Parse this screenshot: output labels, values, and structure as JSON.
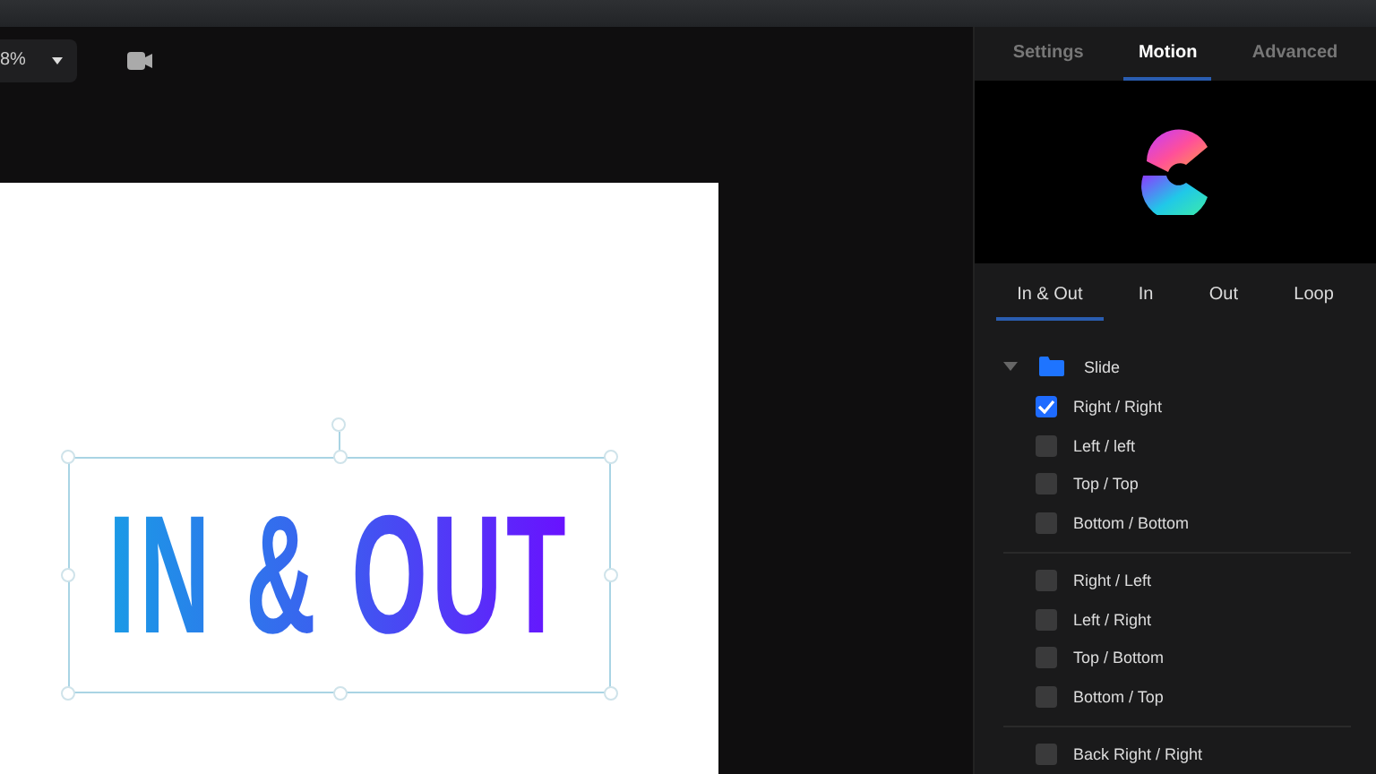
{
  "toolbar": {
    "zoom": "8%"
  },
  "canvas": {
    "text": "IN & OUT"
  },
  "panel": {
    "tabs": [
      {
        "label": "Settings",
        "selected": false
      },
      {
        "label": "Motion",
        "selected": true
      },
      {
        "label": "Advanced",
        "selected": false
      }
    ],
    "subtabs": [
      {
        "label": "In & Out",
        "selected": true
      },
      {
        "label": "In",
        "selected": false
      },
      {
        "label": "Out",
        "selected": false
      },
      {
        "label": "Loop",
        "selected": false
      }
    ],
    "group": {
      "label": "Slide",
      "expanded": true,
      "sections": [
        [
          {
            "label": "Right / Right",
            "checked": true
          },
          {
            "label": "Left / left",
            "checked": false
          },
          {
            "label": "Top / Top",
            "checked": false
          },
          {
            "label": "Bottom / Bottom",
            "checked": false
          }
        ],
        [
          {
            "label": "Right / Left",
            "checked": false
          },
          {
            "label": "Left / Right",
            "checked": false
          },
          {
            "label": "Top / Bottom",
            "checked": false
          },
          {
            "label": "Bottom / Top",
            "checked": false
          }
        ],
        [
          {
            "label": "Back Right / Right",
            "checked": false
          }
        ]
      ]
    }
  }
}
